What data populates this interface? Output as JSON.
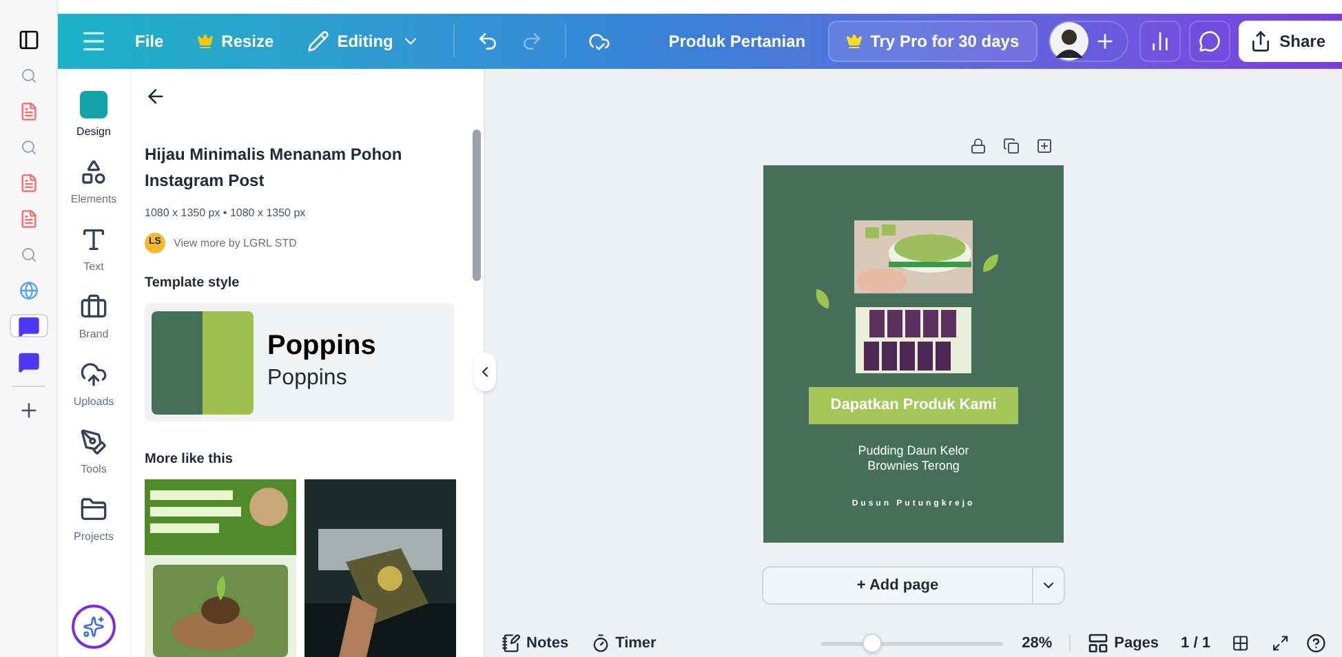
{
  "topbar": {
    "menu": [
      {
        "label": "File",
        "kind": "plain"
      },
      {
        "label": "Resize",
        "kind": "crown"
      },
      {
        "label": "Editing",
        "kind": "edit"
      }
    ],
    "title": "Produk Pertanian",
    "pro_button": "Try Pro for 30 days",
    "share": "Share"
  },
  "browser_strip": [
    {
      "kind": "tab",
      "selected": false
    },
    {
      "kind": "search",
      "selected": false
    },
    {
      "kind": "pdf",
      "selected": false
    },
    {
      "kind": "search",
      "selected": false
    },
    {
      "kind": "pdf",
      "selected": false
    },
    {
      "kind": "pdf",
      "selected": false
    },
    {
      "kind": "search",
      "selected": false
    },
    {
      "kind": "globe",
      "selected": false
    },
    {
      "kind": "chat",
      "selected": true
    },
    {
      "kind": "chat",
      "selected": false
    }
  ],
  "nav": [
    {
      "label": "Design",
      "kind": "design",
      "selected": true
    },
    {
      "label": "Elements",
      "kind": "elements",
      "selected": false
    },
    {
      "label": "Text",
      "kind": "text",
      "selected": false
    },
    {
      "label": "Brand",
      "kind": "brand",
      "selected": false
    },
    {
      "label": "Uploads",
      "kind": "uploads",
      "selected": false
    },
    {
      "label": "Tools",
      "kind": "tools",
      "selected": false
    },
    {
      "label": "Projects",
      "kind": "projects",
      "selected": false
    }
  ],
  "panel": {
    "title": "Hijau Minimalis Menanam Pohon Instagram Post",
    "size": "1080 x 1350 px • 1080 x 1350 px",
    "author_initials": "LS",
    "author_link": "View more by LGRL STD",
    "style_heading": "Template style",
    "palette": [
      {
        "color": "#466f59"
      },
      {
        "color": "#9fc04f"
      }
    ],
    "font_heading": "Poppins",
    "font_body": "Poppins",
    "more_heading": "More like this"
  },
  "design": {
    "headline": "Dapatkan Produk Kami",
    "lines": [
      "Pudding Daun Kelor",
      "Brownies Terong"
    ],
    "footer": "Dusun Putungkrejo"
  },
  "add_page": "+ Add page",
  "bottombar": {
    "notes": "Notes",
    "timer": "Timer",
    "zoom": {
      "level": 0.28
    },
    "zoom_reading": "28%",
    "pages": "Pages",
    "page_count": "1 / 1"
  }
}
